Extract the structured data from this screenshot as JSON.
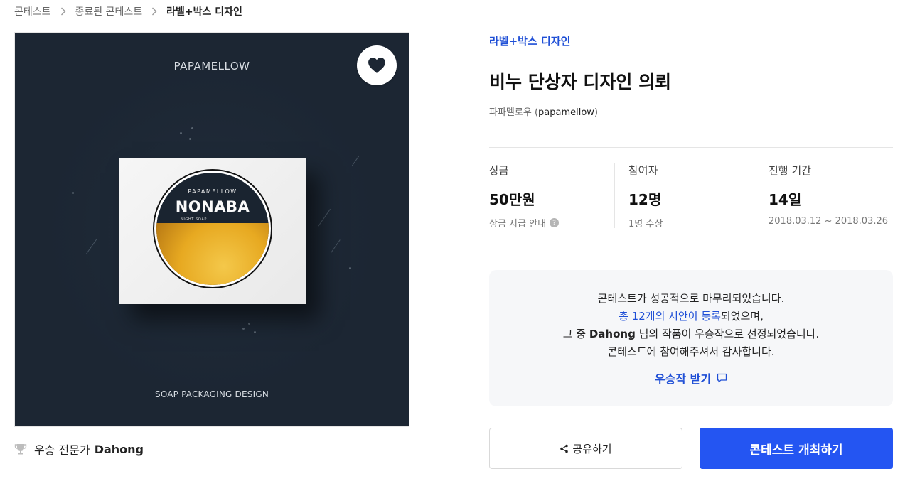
{
  "breadcrumb": {
    "items": [
      "콘테스트",
      "종료된 콘테스트",
      "라벨+박스 디자인"
    ]
  },
  "hero": {
    "top_brand": "PAPAMELLOW",
    "bottom_tag": "SOAP PACKAGING DESIGN",
    "label_brand": "PAPAMELLOW",
    "label_name": "NONABA",
    "label_sub": "NIGHT SOAP"
  },
  "winner": {
    "prefix": "우승 전문가",
    "name": "Dahong"
  },
  "contest": {
    "category": "라벨+박스 디자인",
    "title": "비누 단상자 디자인 의뢰",
    "host_name": "파파멜로우",
    "host_handle": "papamellow",
    "host_open": "(",
    "host_close": ")"
  },
  "stats": [
    {
      "label": "상금",
      "value": "50만원",
      "note": "상금 지급 안내"
    },
    {
      "label": "참여자",
      "value": "12명",
      "note": "1명 수상"
    },
    {
      "label": "진행 기간",
      "value": "14일",
      "note": "2018.03.12 ~ 2018.03.26"
    }
  ],
  "notice": {
    "line1": "콘테스트가 성공적으로 마무리되었습니다.",
    "line2_link": "총 12개의 시안이 등록",
    "line2_rest": "되었으며,",
    "line3_pre": "그 중 ",
    "line3_name": "Dahong",
    "line3_post": " 님의 작품이 우승작으로 선정되었습니다.",
    "line4": "콘테스트에 참여해주셔서 감사합니다.",
    "cta": "우승작 받기"
  },
  "buttons": {
    "share": "공유하기",
    "host": "콘테스트 개최하기"
  },
  "colors": {
    "accent": "#2455f2",
    "link": "#1f4fd6",
    "hero_bg": "#1c2633"
  }
}
